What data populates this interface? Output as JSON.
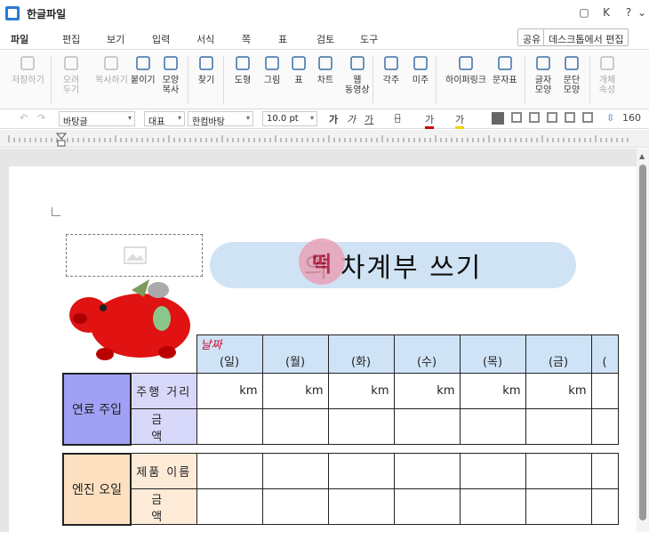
{
  "app": {
    "title": "한글파일",
    "controls": [
      "▢",
      "K",
      "?",
      "⌄"
    ]
  },
  "menu": [
    "파일",
    "편집",
    "보기",
    "입력",
    "서식",
    "쪽",
    "표",
    "검토",
    "도구"
  ],
  "menu_buttons": [
    "공유",
    "데스크톱에서 편집"
  ],
  "toolbar": [
    {
      "label": "저장하기",
      "icon": "save-icon",
      "disabled": true
    },
    {
      "label": "오려\n두기",
      "icon": "cut-icon",
      "disabled": true
    },
    {
      "label": "복사하기",
      "icon": "copy-icon",
      "disabled": true
    },
    {
      "label": "붙이기",
      "icon": "paste-icon",
      "disabled": false
    },
    {
      "label": "모양\n복사",
      "icon": "format-copy-icon",
      "disabled": false
    },
    {
      "label": "찾기",
      "icon": "find-icon",
      "disabled": false
    },
    {
      "label": "도형",
      "icon": "shape-icon",
      "disabled": false
    },
    {
      "label": "그림",
      "icon": "picture-icon",
      "disabled": false
    },
    {
      "label": "표",
      "icon": "table-icon",
      "disabled": false
    },
    {
      "label": "차트",
      "icon": "chart-icon",
      "disabled": false
    },
    {
      "label": "웹\n동영상",
      "icon": "web-video-icon",
      "disabled": false
    },
    {
      "label": "각주",
      "icon": "footnote-icon",
      "disabled": false
    },
    {
      "label": "미주",
      "icon": "endnote-icon",
      "disabled": false
    },
    {
      "label": "하이퍼링크",
      "icon": "hyperlink-icon",
      "disabled": false
    },
    {
      "label": "문자표",
      "icon": "symbol-icon",
      "disabled": false
    },
    {
      "label": "글자\n모양",
      "icon": "char-shape-icon",
      "disabled": false
    },
    {
      "label": "문단\n모양",
      "icon": "para-shape-icon",
      "disabled": false
    },
    {
      "label": "개체\n속성",
      "icon": "object-props-icon",
      "disabled": true
    }
  ],
  "format": {
    "style": "바탕글",
    "lang": "대표",
    "font": "한컴바탕",
    "size": "10.0 pt",
    "bold": "가",
    "italic": "가",
    "underline": "가",
    "strike": "가̶",
    "color": "가",
    "highlight": "가",
    "line_spacing": "160"
  },
  "document": {
    "title": "의 차계부 쓰기",
    "stamp": "떡",
    "table": {
      "date_label": "날짜",
      "days": [
        "(일)",
        "(월)",
        "(화)",
        "(수)",
        "(목)",
        "(금)",
        "("
      ],
      "groups": [
        {
          "name": "연료 주입",
          "color": "#a0a0f5",
          "sub_color": "#d8d8fa",
          "rows": [
            {
              "label": "주행 거리",
              "unit": "km"
            },
            {
              "label": "금 액",
              "unit": ""
            }
          ]
        },
        {
          "name": "엔진 오일",
          "color": "#fce0c0",
          "sub_color": "#fdebd8",
          "rows": [
            {
              "label": "제품 이름",
              "unit": ""
            },
            {
              "label": "금 액",
              "unit": ""
            }
          ]
        }
      ]
    }
  }
}
